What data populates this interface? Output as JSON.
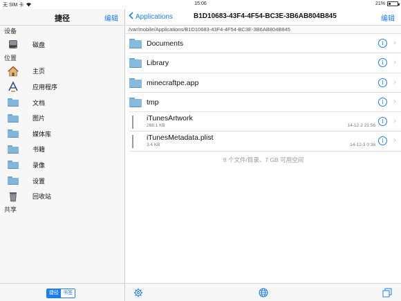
{
  "status": {
    "carrier": "无 SIM 卡",
    "time": "15:06",
    "battery": "21%",
    "battery_level": 0.21
  },
  "sidebar": {
    "title": "捷径",
    "edit_label": "编辑",
    "sections": {
      "devices": "设备",
      "locations": "位置",
      "shared": "共享"
    },
    "devices": [
      {
        "label": "磁盘",
        "icon": "disk-icon"
      }
    ],
    "locations": [
      {
        "label": "主页",
        "icon": "home-icon"
      },
      {
        "label": "应用程序",
        "icon": "applications-icon"
      },
      {
        "label": "文档",
        "icon": "folder-icon"
      },
      {
        "label": "图片",
        "icon": "folder-icon"
      },
      {
        "label": "媒体库",
        "icon": "folder-icon"
      },
      {
        "label": "书籍",
        "icon": "folder-icon"
      },
      {
        "label": "录像",
        "icon": "folder-icon"
      },
      {
        "label": "设置",
        "icon": "folder-icon"
      },
      {
        "label": "回收站",
        "icon": "trash-icon"
      }
    ],
    "segment": {
      "active": "捷径",
      "inactive": "书签"
    }
  },
  "main": {
    "back_label": "Applications",
    "title": "B1D10683-43F4-4F54-BC3E-3B6AB804B845",
    "edit_label": "编辑",
    "path": "/var/mobile/Applications/B1D10683-43F4-4F54-BC3E-3B6AB804B845",
    "folders": [
      {
        "name": "Documents"
      },
      {
        "name": "Library"
      },
      {
        "name": "minecraftpe.app"
      },
      {
        "name": "tmp"
      }
    ],
    "files": [
      {
        "name": "iTunesArtwork",
        "size": "268.1 KB",
        "date": "14-12-2 21:56"
      },
      {
        "name": "iTunesMetadata.plist",
        "size": "3.4 KB",
        "date": "14-12-3 0:36"
      }
    ],
    "summary": "6 个文件/目录、7 GB 可用空间"
  },
  "colors": {
    "accent": "#1a7cf2",
    "folder": "#86bbe0"
  }
}
